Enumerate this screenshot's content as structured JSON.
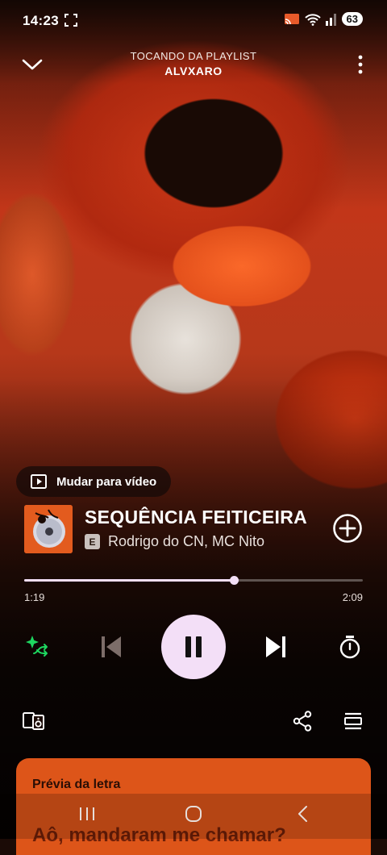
{
  "status_bar": {
    "time": "14:23",
    "battery": "63"
  },
  "header": {
    "context_label": "TOCANDO DA PLAYLIST",
    "playlist_name": "ALVXARO"
  },
  "video_switch": {
    "label": "Mudar para vídeo"
  },
  "track": {
    "title": "SEQUÊNCIA FEITICEIRA",
    "explicit_badge": "E",
    "artists": "Rodrigo do CN, MC Nito"
  },
  "progress": {
    "elapsed": "1:19",
    "duration": "2:09",
    "fraction": 0.62
  },
  "lyrics": {
    "header": "Prévia da letra",
    "first_line": "Aô, mandaram me chamar?"
  },
  "colors": {
    "accent": "#f3dff7",
    "lyrics_card": "#dd5519",
    "smart_shuffle": "#1ed760"
  },
  "icons": {
    "collapse": "chevron-down-icon",
    "more": "more-vertical-icon",
    "video": "video-icon",
    "add": "add-circle-icon",
    "smart_shuffle": "smart-shuffle-icon",
    "previous": "skip-previous-icon",
    "pause": "pause-icon",
    "next": "skip-next-icon",
    "sleep_timer": "timer-icon",
    "devices": "devices-icon",
    "share": "share-icon",
    "queue": "queue-icon"
  }
}
